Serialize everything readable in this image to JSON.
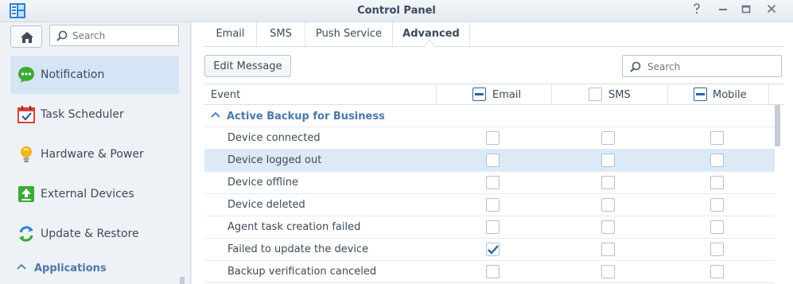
{
  "window": {
    "title": "Control Panel",
    "app_icon": "control-panel-icon",
    "buttons": [
      "help-icon",
      "minimize-icon",
      "maximize-icon",
      "close-icon"
    ]
  },
  "sidebar": {
    "search_placeholder": "Search",
    "items": [
      {
        "label": "Notification",
        "icon": "notification-icon",
        "active": true
      },
      {
        "label": "Task Scheduler",
        "icon": "task-scheduler-icon",
        "active": false
      },
      {
        "label": "Hardware & Power",
        "icon": "hardware-power-icon",
        "active": false
      },
      {
        "label": "External Devices",
        "icon": "external-devices-icon",
        "active": false
      },
      {
        "label": "Update & Restore",
        "icon": "update-restore-icon",
        "active": false
      }
    ],
    "section": "Applications"
  },
  "tabs": [
    {
      "label": "Email",
      "active": false
    },
    {
      "label": "SMS",
      "active": false
    },
    {
      "label": "Push Service",
      "active": false
    },
    {
      "label": "Advanced",
      "active": true
    }
  ],
  "toolbar": {
    "edit_button": "Edit Message",
    "search_placeholder": "Search"
  },
  "table": {
    "columns": [
      {
        "label": "Event"
      },
      {
        "label": "Email",
        "checkbox": "partial"
      },
      {
        "label": "SMS",
        "checkbox": "unchecked"
      },
      {
        "label": "Mobile",
        "checkbox": "partial"
      }
    ],
    "group": "Active Backup for Business",
    "rows": [
      {
        "event": "Device connected",
        "email": false,
        "sms": false,
        "mobile": false,
        "selected": false
      },
      {
        "event": "Device logged out",
        "email": false,
        "sms": false,
        "mobile": false,
        "selected": true
      },
      {
        "event": "Device offline",
        "email": false,
        "sms": false,
        "mobile": false,
        "selected": false
      },
      {
        "event": "Device deleted",
        "email": false,
        "sms": false,
        "mobile": false,
        "selected": false
      },
      {
        "event": "Agent task creation failed",
        "email": false,
        "sms": false,
        "mobile": false,
        "selected": false
      },
      {
        "event": "Failed to update the device",
        "email": true,
        "sms": false,
        "mobile": false,
        "selected": false
      },
      {
        "event": "Backup verification canceled",
        "email": false,
        "sms": false,
        "mobile": false,
        "selected": false
      }
    ]
  },
  "colors": {
    "accent": "#2a64a4",
    "section_text": "#4a78a8",
    "selected_row": "#dce9f7",
    "active_sidebar": "#d5e5f6"
  }
}
